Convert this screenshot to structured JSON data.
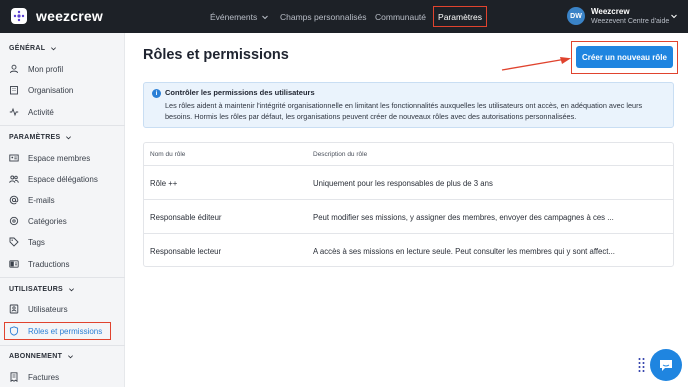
{
  "topbar": {
    "brand": "weezcrew",
    "nav": [
      {
        "label": "Événements",
        "has_dropdown": true
      },
      {
        "label": "Champs personnalisés"
      },
      {
        "label": "Communauté"
      },
      {
        "label": "Paramètres",
        "active": true
      }
    ],
    "account": {
      "initials": "DW",
      "name": "Weezcrew",
      "subtitle": "Weezevent Centre d'aide"
    }
  },
  "sidebar": {
    "sections": [
      {
        "title": "GÉNÉRAL",
        "items": [
          {
            "label": "Mon profil",
            "icon": "user-icon"
          },
          {
            "label": "Organisation",
            "icon": "building-icon"
          },
          {
            "label": "Activité",
            "icon": "activity-icon"
          }
        ]
      },
      {
        "title": "PARAMÈTRES",
        "items": [
          {
            "label": "Espace membres",
            "icon": "id-card-icon"
          },
          {
            "label": "Espace délégations",
            "icon": "users-icon"
          },
          {
            "label": "E-mails",
            "icon": "at-icon"
          },
          {
            "label": "Catégories",
            "icon": "category-icon"
          },
          {
            "label": "Tags",
            "icon": "tag-icon"
          },
          {
            "label": "Traductions",
            "icon": "translate-icon"
          }
        ]
      },
      {
        "title": "UTILISATEURS",
        "items": [
          {
            "label": "Utilisateurs",
            "icon": "user-list-icon"
          },
          {
            "label": "Rôles et permissions",
            "icon": "shield-icon",
            "active": true
          }
        ]
      },
      {
        "title": "ABONNEMENT",
        "items": [
          {
            "label": "Factures",
            "icon": "invoice-icon"
          }
        ]
      }
    ]
  },
  "main": {
    "title": "Rôles et permissions",
    "create_button": "Créer un nouveau rôle",
    "info": {
      "title": "Contrôler les permissions des utilisateurs",
      "body": "Les rôles aident à maintenir l'intégrité organisationnelle en limitant les fonctionnalités auxquelles les utilisateurs ont accès, en adéquation avec leurs besoins. Hormis les rôles par défaut, les organisations peuvent créer de nouveaux rôles avec des autorisations personnalisées."
    },
    "table": {
      "headers": [
        "Nom du rôle",
        "Description du rôle"
      ],
      "rows": [
        {
          "name": "Rôle ++",
          "description": "Uniquement pour les responsables de plus de 3 ans"
        },
        {
          "name": "Responsable éditeur",
          "description": "Peut modifier ses missions, y assigner des membres, envoyer des campagnes à ces ..."
        },
        {
          "name": "Responsable lecteur",
          "description": "A accès à ses missions en lecture seule. Peut consulter les membres qui y sont affect..."
        }
      ]
    }
  },
  "colors": {
    "accent": "#1f85e0",
    "highlight": "#e0432e",
    "topbar": "#1d2127"
  }
}
